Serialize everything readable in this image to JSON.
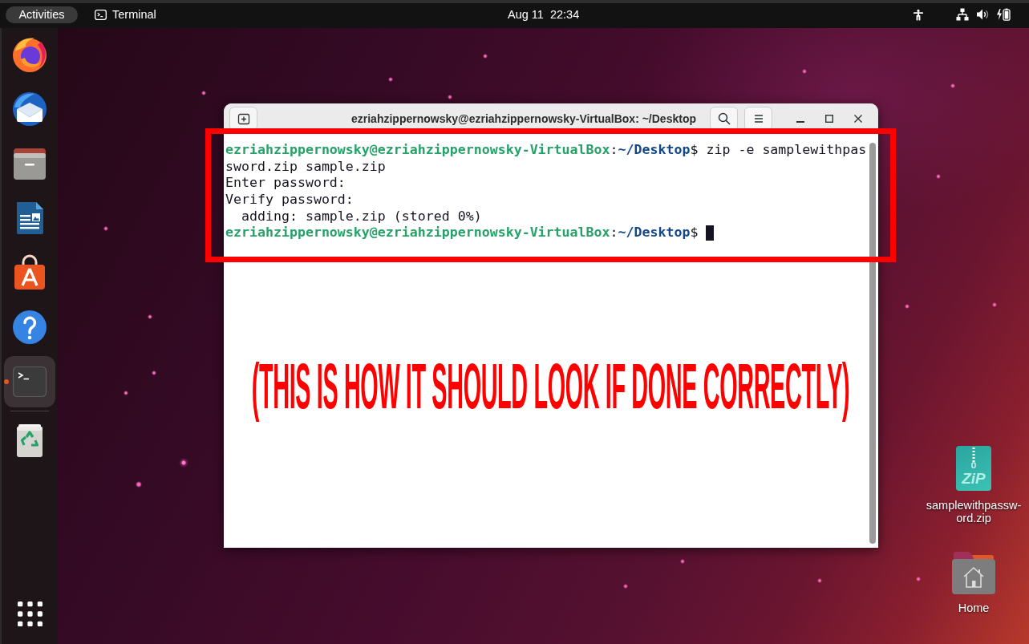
{
  "top_bar": {
    "activities": {
      "label": "Activities"
    },
    "app_menu": {
      "label": "Terminal"
    },
    "clock": "Aug 11  22:34"
  },
  "dock": {
    "items": [
      {
        "kind": "firefox",
        "running": false,
        "selected": false
      },
      {
        "kind": "thunderbird",
        "running": false,
        "selected": false
      },
      {
        "kind": "files",
        "running": false,
        "selected": false
      },
      {
        "kind": "writer",
        "running": false,
        "selected": false
      },
      {
        "kind": "app_center",
        "running": false,
        "selected": false
      },
      {
        "kind": "help",
        "running": false,
        "selected": false
      },
      {
        "kind": "terminal",
        "running": true,
        "selected": true
      },
      {
        "kind": "trash",
        "running": false,
        "selected": false
      }
    ]
  },
  "window": {
    "title": "ezriahzippernowsky@ezriahzippernowsky-VirtualBox: ~/Desktop",
    "terminal": {
      "lines": [
        {
          "segments": [
            {
              "kind": "user",
              "text": "ezriahzippernowsky@ezriahzippernowsky-VirtualBox"
            },
            {
              "kind": "plain",
              "text": ":"
            },
            {
              "kind": "path",
              "text": "~/Desktop"
            },
            {
              "kind": "plain",
              "text": "$ zip -e samplewithpas"
            }
          ],
          "cursor": false
        },
        {
          "segments": [
            {
              "kind": "plain",
              "text": "sword.zip sample.zip"
            }
          ],
          "cursor": false
        },
        {
          "segments": [
            {
              "kind": "plain",
              "text": "Enter password:"
            }
          ],
          "cursor": false
        },
        {
          "segments": [
            {
              "kind": "plain",
              "text": "Verify password:"
            }
          ],
          "cursor": false
        },
        {
          "segments": [
            {
              "kind": "plain",
              "text": "  adding: sample.zip (stored 0%)"
            }
          ],
          "cursor": false
        },
        {
          "segments": [
            {
              "kind": "user",
              "text": "ezriahzippernowsky@ezriahzippernowsky-VirtualBox"
            },
            {
              "kind": "plain",
              "text": ":"
            },
            {
              "kind": "path",
              "text": "~/Desktop"
            },
            {
              "kind": "plain",
              "text": "$ "
            }
          ],
          "cursor": true
        }
      ]
    }
  },
  "annotation": {
    "caption": "(THIS IS HOW IT SHOULD LOOK IF DONE CORRECTLY)"
  },
  "desktop_icons": [
    {
      "kind": "zip",
      "label": "samplewithpassw-ord.zip",
      "icon_text": "ZiP"
    },
    {
      "kind": "home",
      "label": "Home"
    }
  ]
}
